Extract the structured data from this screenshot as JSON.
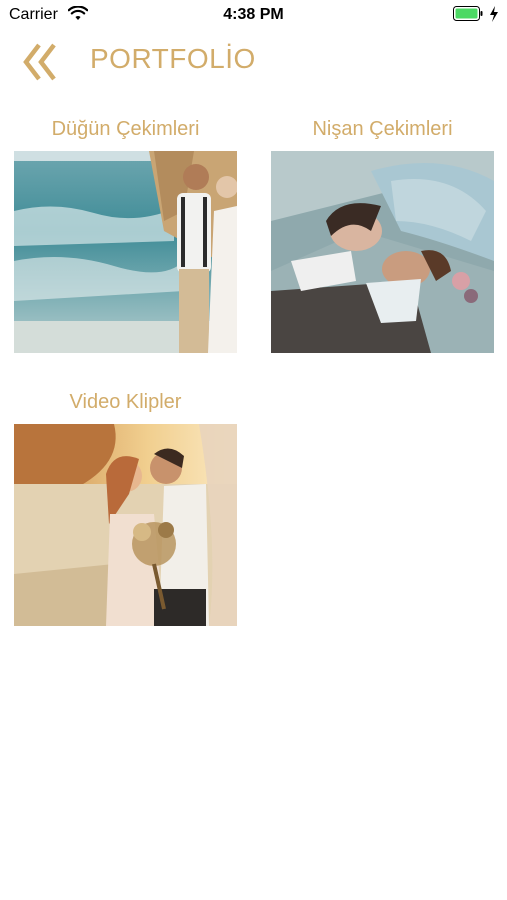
{
  "status": {
    "carrier": "Carrier",
    "time": "4:38 PM"
  },
  "nav": {
    "title": "PORTFOLİO",
    "back_icon": "double-chevron-left-icon"
  },
  "grid": {
    "items": [
      {
        "label": "Düğün Çekimleri"
      },
      {
        "label": "Nişan Çekimleri"
      },
      {
        "label": "Video Klipler"
      }
    ]
  },
  "colors": {
    "accent": "#d2ac6a",
    "background": "#ffffff",
    "battery": "#4cd964"
  }
}
